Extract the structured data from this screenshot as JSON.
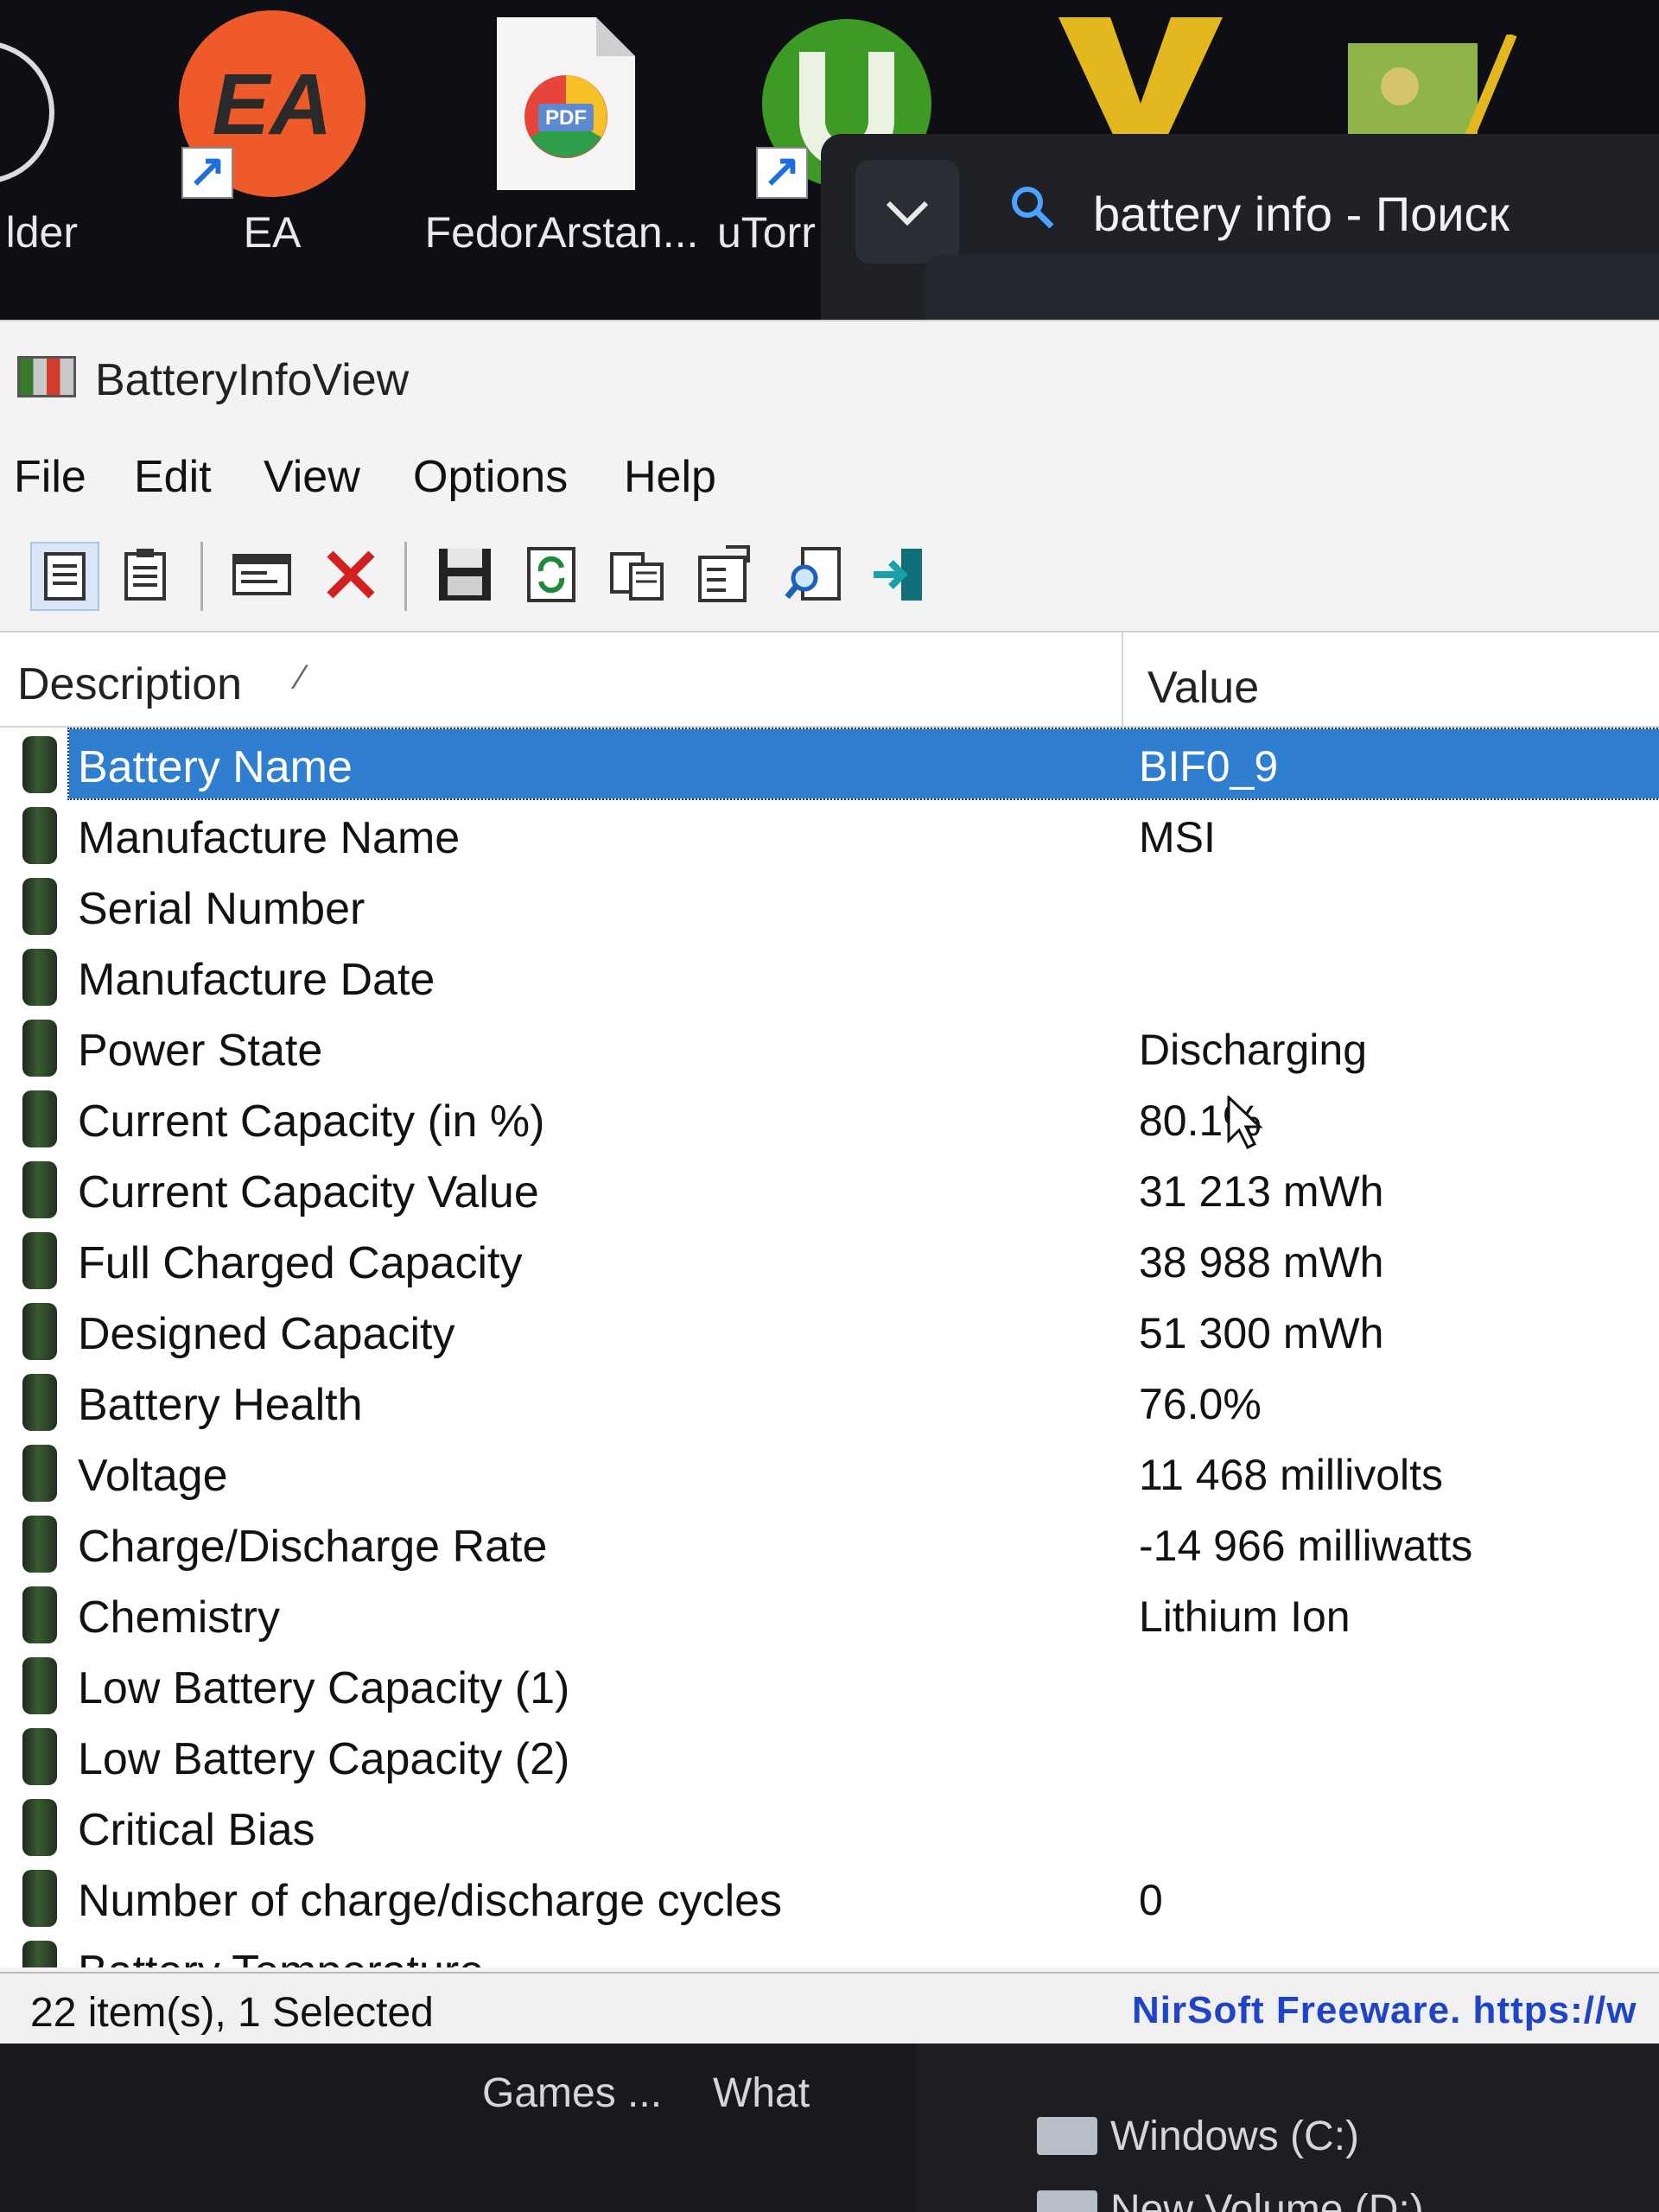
{
  "desktop": {
    "icons": [
      {
        "label": "lder"
      },
      {
        "label": "EA"
      },
      {
        "label": "FedorArstan..."
      },
      {
        "label": "uTorr"
      }
    ]
  },
  "search": {
    "query": "battery info - Поиск"
  },
  "app": {
    "title": "BatteryInfoView",
    "menu": [
      "File",
      "Edit",
      "View",
      "Options",
      "Help"
    ],
    "columns": {
      "description": "Description",
      "value": "Value"
    },
    "rows": [
      {
        "description": "Battery Name",
        "value": "BIF0_9",
        "selected": true
      },
      {
        "description": "Manufacture Name",
        "value": "MSI"
      },
      {
        "description": "Serial Number",
        "value": ""
      },
      {
        "description": "Manufacture Date",
        "value": ""
      },
      {
        "description": "Power State",
        "value": "Discharging"
      },
      {
        "description": "Current Capacity (in %)",
        "value": "80.1%"
      },
      {
        "description": "Current Capacity Value",
        "value": "31 213 mWh"
      },
      {
        "description": "Full Charged Capacity",
        "value": "38 988 mWh"
      },
      {
        "description": "Designed Capacity",
        "value": "51 300 mWh"
      },
      {
        "description": "Battery Health",
        "value": "76.0%"
      },
      {
        "description": "Voltage",
        "value": "11 468 millivolts"
      },
      {
        "description": "Charge/Discharge Rate",
        "value": "-14 966 milliwatts"
      },
      {
        "description": "Chemistry",
        "value": "Lithium Ion"
      },
      {
        "description": "Low Battery Capacity (1)",
        "value": ""
      },
      {
        "description": "Low Battery Capacity (2)",
        "value": ""
      },
      {
        "description": "Critical Bias",
        "value": ""
      },
      {
        "description": "Number of charge/discharge cycles",
        "value": "0"
      },
      {
        "description": "Battery Temperature",
        "value": ""
      }
    ],
    "status": {
      "items": "22 item(s), 1 Selected",
      "credit": "NirSoft Freeware. https://w"
    }
  },
  "behind": {
    "labels": [
      "Games ...",
      "What"
    ],
    "drives": [
      "Windows (C:)",
      "New Volume (D:)"
    ]
  }
}
